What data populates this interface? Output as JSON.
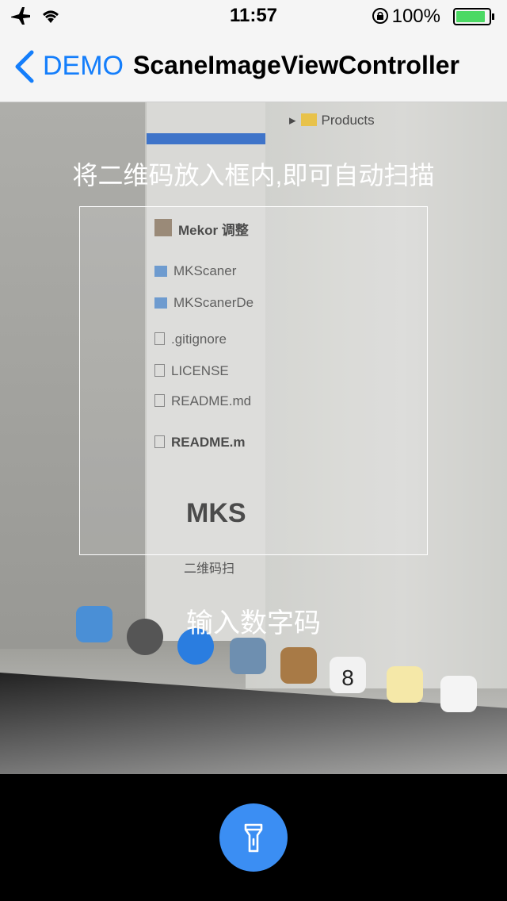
{
  "status_bar": {
    "time": "11:57",
    "battery_percent": "100%",
    "battery_level": 1.0
  },
  "nav": {
    "back_label": "DEMO",
    "title": "ScaneImageViewController"
  },
  "scanner": {
    "hint": "将二维码放入框内,即可自动扫描",
    "manual_entry": "输入数字码"
  },
  "background_photo": {
    "products_label": "Products",
    "commit_author": "Mekor 调整",
    "files": [
      "MKScaner",
      "MKScanerDe",
      ".gitignore",
      "LICENSE",
      "README.md"
    ],
    "readme_header": "README.m",
    "big_text": "MKS",
    "small_text": "二维码扫",
    "calendar_day": "8"
  },
  "colors": {
    "accent": "#147efb",
    "flashlight_button": "#3b8ef3",
    "battery": "#4cd964"
  },
  "icons": {
    "flashlight": "flashlight-icon",
    "back": "chevron-left-icon"
  }
}
